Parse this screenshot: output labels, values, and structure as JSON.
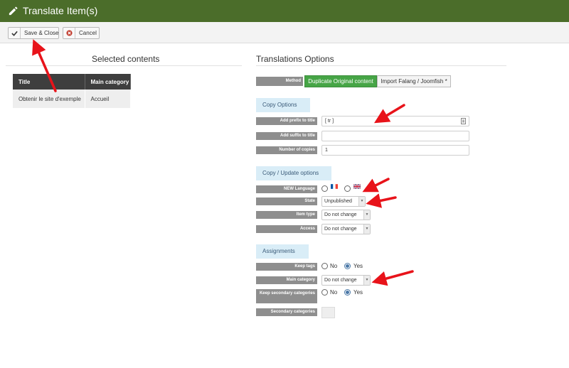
{
  "header": {
    "title": "Translate Item(s)"
  },
  "toolbar": {
    "save_close_label": "Save & Close",
    "cancel_label": "Cancel"
  },
  "selected": {
    "title": "Selected contents",
    "columns": [
      "Title",
      "Main category"
    ],
    "rows": [
      {
        "title": "Obtenir le site d'exemple",
        "category": "Accueil"
      }
    ]
  },
  "translations": {
    "title": "Translations Options",
    "method_label": "Method",
    "method_options": [
      "Duplicate Original content",
      "Import Falang / Joomfish *"
    ],
    "copy_options": {
      "heading": "Copy Options",
      "prefix_label": "Add prefix to title",
      "prefix_value": "[ tr ]",
      "suffix_label": "Add suffix to title",
      "suffix_value": "",
      "copies_label": "Number of copies",
      "copies_value": "1"
    },
    "copy_update": {
      "heading": "Copy / Update options",
      "language_label": "NEW Language",
      "state_label": "State",
      "state_value": "Unpublished",
      "item_type_label": "Item type",
      "item_type_value": "Do not change",
      "access_label": "Access",
      "access_value": "Do not change"
    },
    "assignments": {
      "heading": "Assignments",
      "keep_tags_label": "Keep tags",
      "main_category_label": "Main category",
      "main_category_value": "Do not change",
      "keep_secondary_label": "Keep secondary categories",
      "secondary_categories_label": "Secondary categories",
      "no_label": "No",
      "yes_label": "Yes"
    }
  },
  "colors": {
    "header": "#4b6d2a",
    "accent_green": "#46a546",
    "section_bg": "#d9edf7",
    "label_bg": "#8e8e8e",
    "arrow": "#e8131a"
  }
}
